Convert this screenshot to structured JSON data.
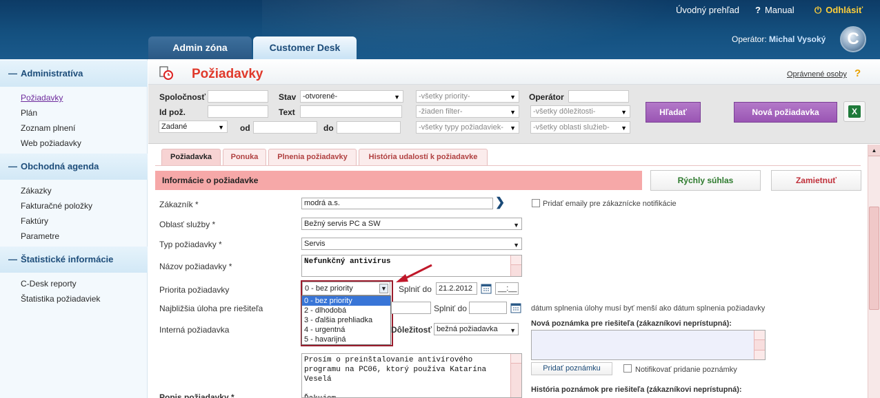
{
  "header": {
    "links": {
      "overview": "Úvodný prehľad",
      "manual": "Manual",
      "logout": "Odhlásiť"
    },
    "operator_label": "Operátor:",
    "operator_name": "Michal Vysoký",
    "logo_letter": "C",
    "tabs": {
      "admin": "Admin zóna",
      "cdesk": "Customer Desk"
    }
  },
  "sidebar": {
    "groups": [
      {
        "title": "Administratíva",
        "items": [
          "Požiadavky",
          "Plán",
          "Zoznam plnení",
          "Web požiadavky"
        ]
      },
      {
        "title": "Obchodná agenda",
        "items": [
          "Zákazky",
          "Fakturačné položky",
          "Faktúry",
          "Parametre"
        ]
      },
      {
        "title": "Štatistické informácie",
        "items": [
          "C-Desk reporty",
          "Štatistika požiadaviek"
        ]
      }
    ]
  },
  "page": {
    "title": "Požiadavky",
    "authorized_link": "Oprávnené osoby",
    "help": "?"
  },
  "filters": {
    "company_label": "Spoločnosť",
    "id_label": "Id pož.",
    "state_label": "Stav",
    "text_label": "Text",
    "operator_label": "Operátor",
    "from_label": "od",
    "to_label": "do",
    "state_value": "-otvorené-",
    "date_type_value": "Zadané",
    "priority_value": "-všetky priority-",
    "filter_value": "-žiaden filter-",
    "type_value": "-všetky typy požiadaviek-",
    "importance_value": "-všetky dôležitosti-",
    "service_area_value": "-všetky oblasti služieb-",
    "search_button": "Hľadať",
    "new_request_button": "Nová požiadavka",
    "excel": "X"
  },
  "content_tabs": [
    "Požiadavka",
    "Ponuka",
    "Plnenia požiadavky",
    "História udalostí k požiadavke"
  ],
  "info_bar": "Informácie o požiadavke",
  "buttons": {
    "quick_approve": "Rýchly súhlas",
    "reject": "Zamietnuť"
  },
  "form": {
    "customer_label": "Zákazník *",
    "customer_value": "modrá a.s.",
    "add_emails_label": "Pridať emaily pre zákaznícke notifikácie",
    "service_area_label": "Oblasť služby *",
    "service_area_value": "Bežný servis PC a SW",
    "type_label": "Typ požiadavky *",
    "type_value": "Servis",
    "name_label": "Názov požiadavky *",
    "name_value": "Nefunkčný antivírus",
    "priority_label": "Priorita požiadavky",
    "priority_value": "0 - bez priority",
    "priority_options": [
      "0 - bez priority",
      "2 - dlhodobá",
      "3 - ďalšia prehliadka",
      "4 - urgentná",
      "5 - havarijná"
    ],
    "fulfill_label": "Splniť do",
    "fulfill_date": "21.2.2012",
    "fulfill_time": "__:__",
    "next_task_label": "Najbližšia úloha pre riešiteľa",
    "next_task_fulfill_label": "Splniť do",
    "date_note": "dátum splnenia úlohy musí byť menší ako dátum splnenia požiadavky",
    "internal_label": "Interná požiadavka",
    "importance_label": "Dôležitosť",
    "importance_value": "bežná požiadavka",
    "new_note_label": "Nová poznámka pre riešiteľa (zákazníkovi neprístupná):",
    "add_note_button": "Pridať poznámku",
    "notify_label": "Notifikovať pridanie poznámky",
    "history_label": "História poznámok pre riešiteľa (zákazníkovi neprístupná):",
    "description_label": "Popis požiadavky *",
    "description_value": "Prosím o preinštalovanie antivírového\nprogramu na PC06, ktorý používa Katarína\nVeselá\n\nĎakujem"
  }
}
